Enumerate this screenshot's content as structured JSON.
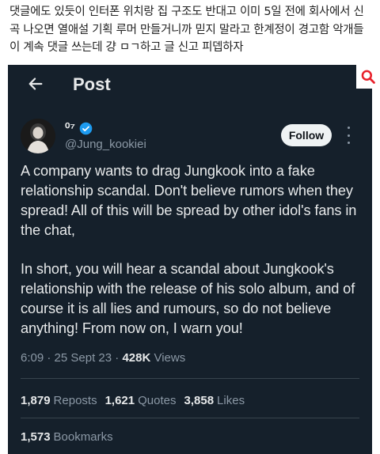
{
  "caption": "댓글에도 있듯이 인터폰 위치랑 집 구조도 반대고 이미 5일 전에 회사에서 신곡 나오면 열애설 기획 루머 만들거니까 믿지 말라고 한계정이 경고함 악개들이 계속 댓글 쓰는데 걍 ㅁㄱ하고 글 신고 피뎁하자",
  "header": {
    "title": "Post",
    "back_icon": "arrow-left-icon",
    "search_icon": "search-icon",
    "search_color": "#e8202a"
  },
  "author": {
    "name": "⁰⁷",
    "handle": "@Jung_kookiei",
    "verified_color": "#1d9bf0"
  },
  "follow_label": "Follow",
  "body": {
    "p1": "A company wants to drag Jungkook into a fake relationship scandal. Don't believe rumors when they spread! All of this will be spread by other idol's fans in the chat,",
    "p2": "In short, you will hear a scandal about Jungkook's relationship with the release of his solo album, and of course it is all lies and rumours, so do not believe anything! From now on, I warn you!"
  },
  "meta": {
    "time": "6:09",
    "date": "25 Sept 23",
    "views_count": "428K",
    "views_label": "Views"
  },
  "stats": {
    "reposts_count": "1,879",
    "reposts_label": "Reposts",
    "quotes_count": "1,621",
    "quotes_label": "Quotes",
    "likes_count": "3,858",
    "likes_label": "Likes",
    "bookmarks_count": "1,573",
    "bookmarks_label": "Bookmarks"
  },
  "colors": {
    "background": "#15202b",
    "text": "#e7e9ea",
    "muted": "#8b98a5"
  }
}
